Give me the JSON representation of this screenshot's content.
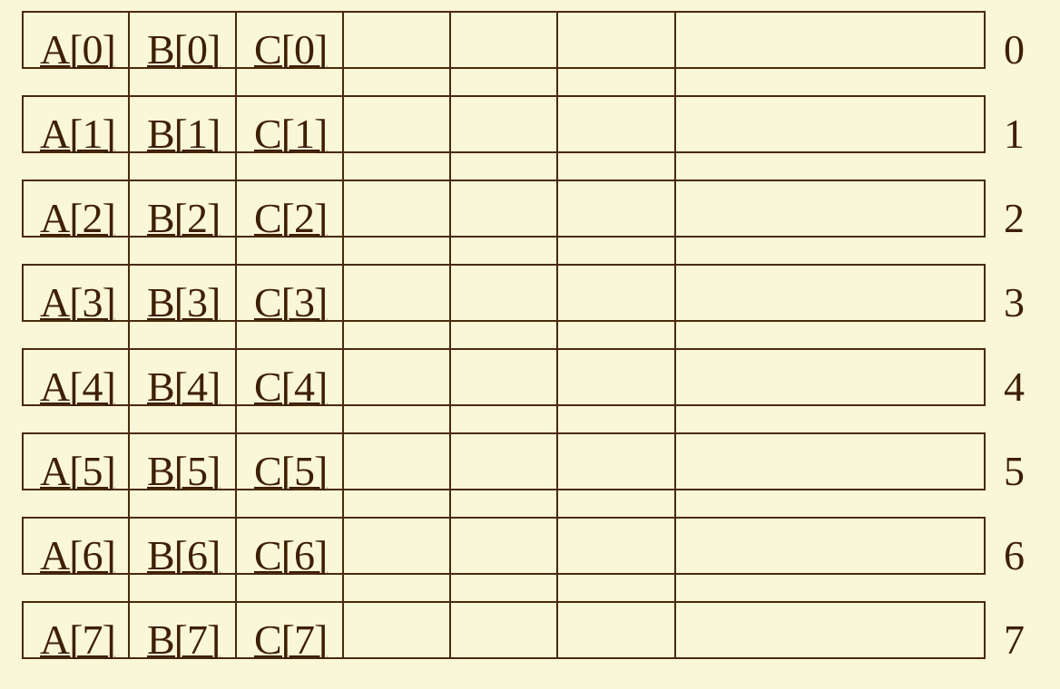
{
  "rows": [
    {
      "index": "0",
      "cells": [
        "A[0]",
        "B[0]",
        "C[0]"
      ]
    },
    {
      "index": "1",
      "cells": [
        "A[1]",
        "B[1]",
        "C[1]"
      ]
    },
    {
      "index": "2",
      "cells": [
        "A[2]",
        "B[2]",
        "C[2]"
      ]
    },
    {
      "index": "3",
      "cells": [
        "A[3]",
        "B[3]",
        "C[3]"
      ]
    },
    {
      "index": "4",
      "cells": [
        "A[4]",
        "B[4]",
        "C[4]"
      ]
    },
    {
      "index": "5",
      "cells": [
        "A[5]",
        "B[5]",
        "C[5]"
      ]
    },
    {
      "index": "6",
      "cells": [
        "A[6]",
        "B[6]",
        "C[6]"
      ]
    },
    {
      "index": "7",
      "cells": [
        "A[7]",
        "B[7]",
        "C[7]"
      ]
    }
  ],
  "colors": {
    "background": "#faf6d8",
    "line": "#4a2a0c",
    "text": "#3e1f04"
  }
}
